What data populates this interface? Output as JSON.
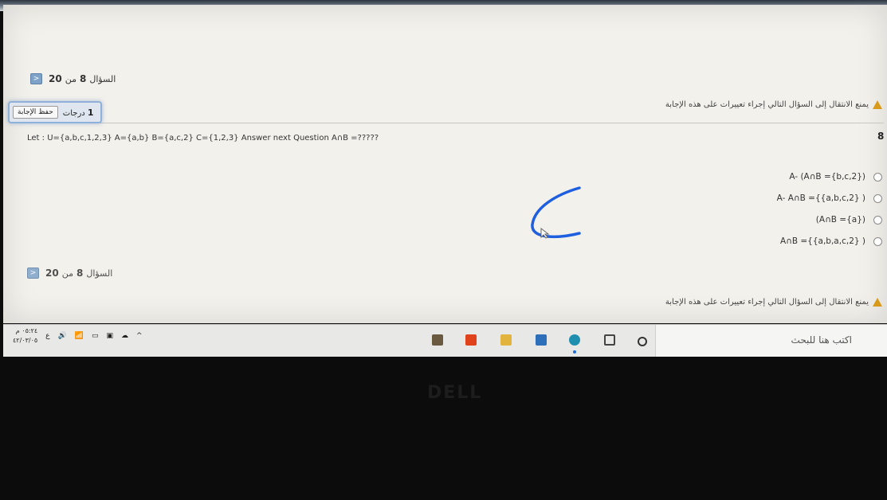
{
  "nav": {
    "question_label": "السؤال",
    "current": "8",
    "of_label": "من",
    "total": "20",
    "back_arrow": "<"
  },
  "warning": {
    "text": "يمنع الانتقال إلى السؤال التالي إجراء تعييرات على هذه الإجابة",
    "icon": "warning-triangle-icon"
  },
  "save_box": {
    "save_label": "حفظ الإجابة",
    "degree_value": "1",
    "degree_label": "درجات"
  },
  "question": {
    "number": "8",
    "text": "Let : U={a,b,c,1,2,3} A={a,b} B={a,c,2} C={1,2,3} Answer next Question A∩B =?????"
  },
  "options": [
    {
      "label": "A- (A∩B ={b,c,2})"
    },
    {
      "label": "A- A∩B ={{a,b,c,2} )"
    },
    {
      "label": "(A∩B ={a})"
    },
    {
      "label": "A∩B ={{a,b,a,c,2} )"
    }
  ],
  "taskbar": {
    "search_placeholder": "اكتب هنا للبحث",
    "clock_time": "٠٥:٢٤ م",
    "clock_date": "٤٢/٠٣/٠٥",
    "lang": "ع",
    "icons": [
      "cortana-icon",
      "task-view-icon",
      "edge-icon",
      "mail-icon",
      "file-explorer-icon",
      "office-icon",
      "store-icon"
    ]
  },
  "colors": {
    "accent": "#8fb0d8",
    "warning": "#d99a1a",
    "pen": "#1e5fe0"
  },
  "brand": "DELL"
}
